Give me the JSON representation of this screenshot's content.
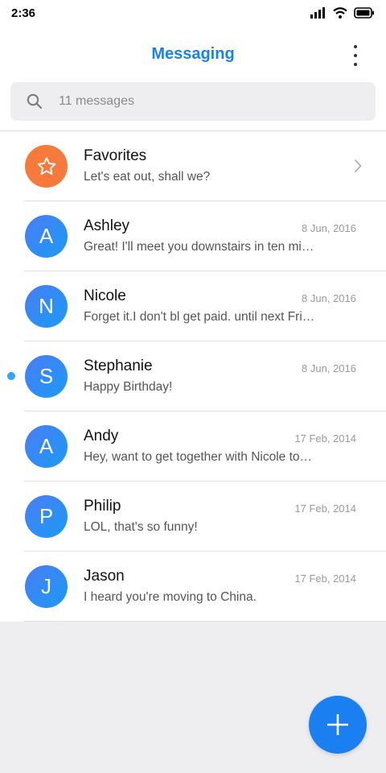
{
  "status_bar": {
    "time": "2:36"
  },
  "header": {
    "title": "Messaging"
  },
  "search": {
    "placeholder": "11 messages"
  },
  "favorites": {
    "name": "Favorites",
    "preview": "Let's eat out, shall we?"
  },
  "conversations": [
    {
      "initial": "A",
      "name": "Ashley",
      "date": "8 Jun, 2016",
      "preview": "Great! I'll meet you downstairs in ten minutes.",
      "unread": false
    },
    {
      "initial": "N",
      "name": "Nicole",
      "date": "8 Jun, 2016",
      "preview": "Forget it.I don't bl get paid. until next Friday.",
      "unread": false
    },
    {
      "initial": "S",
      "name": "Stephanie",
      "date": "8 Jun, 2016",
      "preview": "Happy Birthday!",
      "unread": true
    },
    {
      "initial": "A",
      "name": "Andy",
      "date": "17 Feb, 2014",
      "preview": "Hey, want to get together with Nicole tonight?",
      "unread": false
    },
    {
      "initial": "P",
      "name": "Philip",
      "date": "17 Feb, 2014",
      "preview": "LOL, that's so funny!",
      "unread": false
    },
    {
      "initial": "J",
      "name": "Jason",
      "date": "17 Feb, 2014",
      "preview": "I heard you're moving to China.",
      "unread": false
    }
  ],
  "colors": {
    "accent": "#1a82ee",
    "favorites_avatar": "#f57a3b",
    "unread_dot": "#2ea8f5"
  },
  "icons": [
    "signal-icon",
    "wifi-icon",
    "battery-icon",
    "more-vertical-icon",
    "search-icon",
    "star-icon",
    "chevron-right-icon",
    "plus-icon"
  ]
}
